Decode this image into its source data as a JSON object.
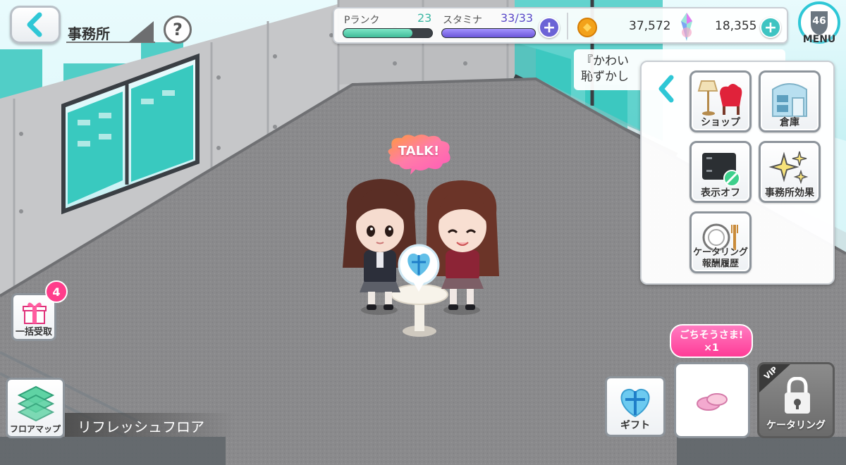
{
  "header": {
    "title": "事務所",
    "help_label": "?"
  },
  "status": {
    "rank_label": "Pランク",
    "rank_value": "23",
    "rank_progress": 0.78,
    "stamina_label": "スタミナ",
    "stamina_value": "33/33",
    "stamina_progress": 1.0,
    "coins": "37,572",
    "gems": "18,355"
  },
  "menu": {
    "level": "46",
    "label": "MENU"
  },
  "message": {
    "line1": "『かわい",
    "line2": "恥ずかし"
  },
  "panel": {
    "tiles": [
      {
        "label": "ショップ",
        "icon": "shop-icon"
      },
      {
        "label": "倉庫",
        "icon": "warehouse-icon"
      },
      {
        "label": "表示オフ",
        "icon": "display-off-icon"
      },
      {
        "label": "事務所効果",
        "icon": "sparkle-icon"
      },
      {
        "label": "ケータリング報酬履歴",
        "line1": "ケータリング",
        "line2": "報酬履歴",
        "icon": "plate-icon"
      }
    ]
  },
  "scene": {
    "talk_label": "TALK!"
  },
  "bottom_left": {
    "gift_badge": "4",
    "gift_receive_label": "一括受取",
    "floor_map_label": "フロアマップ",
    "floor_name": "リフレッシュフロア"
  },
  "bottom_right": {
    "gift_label": "ギフト",
    "treat_line1": "ごちそうさま!",
    "treat_line2": "×1",
    "vip_label": "VIP",
    "catering_label": "ケータリング"
  },
  "colors": {
    "rank_bar": "#4cc9a3",
    "stamina_bar": "#6f57d8",
    "plus_blue": "#6b63d6",
    "plus_teal": "#3fc4c2",
    "badge_pink": "#ff3d8b",
    "accent_cyan": "#2fc7d6"
  }
}
